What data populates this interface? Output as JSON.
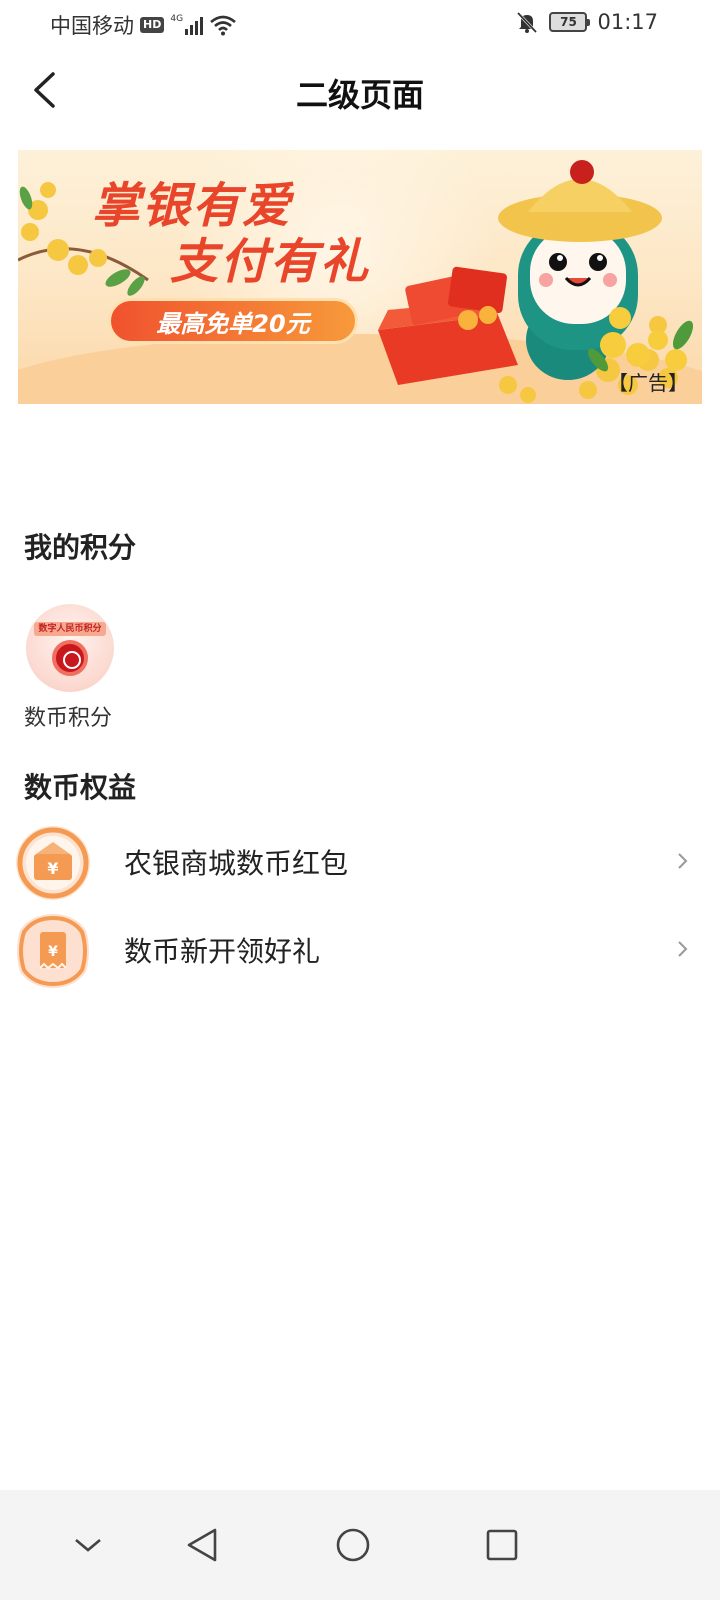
{
  "status_bar": {
    "carrier": "中国移动",
    "hd_badge": "HD",
    "network": "4G",
    "battery": "75",
    "time": "01:17"
  },
  "header": {
    "title": "二级页面"
  },
  "banner": {
    "headline_line1": "掌银有爱",
    "headline_line2": "支付有礼",
    "pill_text": "最高免单20元",
    "ad_tag": "【广告】"
  },
  "points_section": {
    "title": "我的积分",
    "items": [
      {
        "label": "数币积分",
        "logo_text": "数字人民币积分"
      }
    ]
  },
  "benefits_section": {
    "title": "数币权益",
    "items": [
      {
        "label": "农银商城数币红包"
      },
      {
        "label": "数币新开领好礼"
      }
    ]
  },
  "colors": {
    "accent": "#e8452b",
    "icon_orange": "#f59a52"
  }
}
